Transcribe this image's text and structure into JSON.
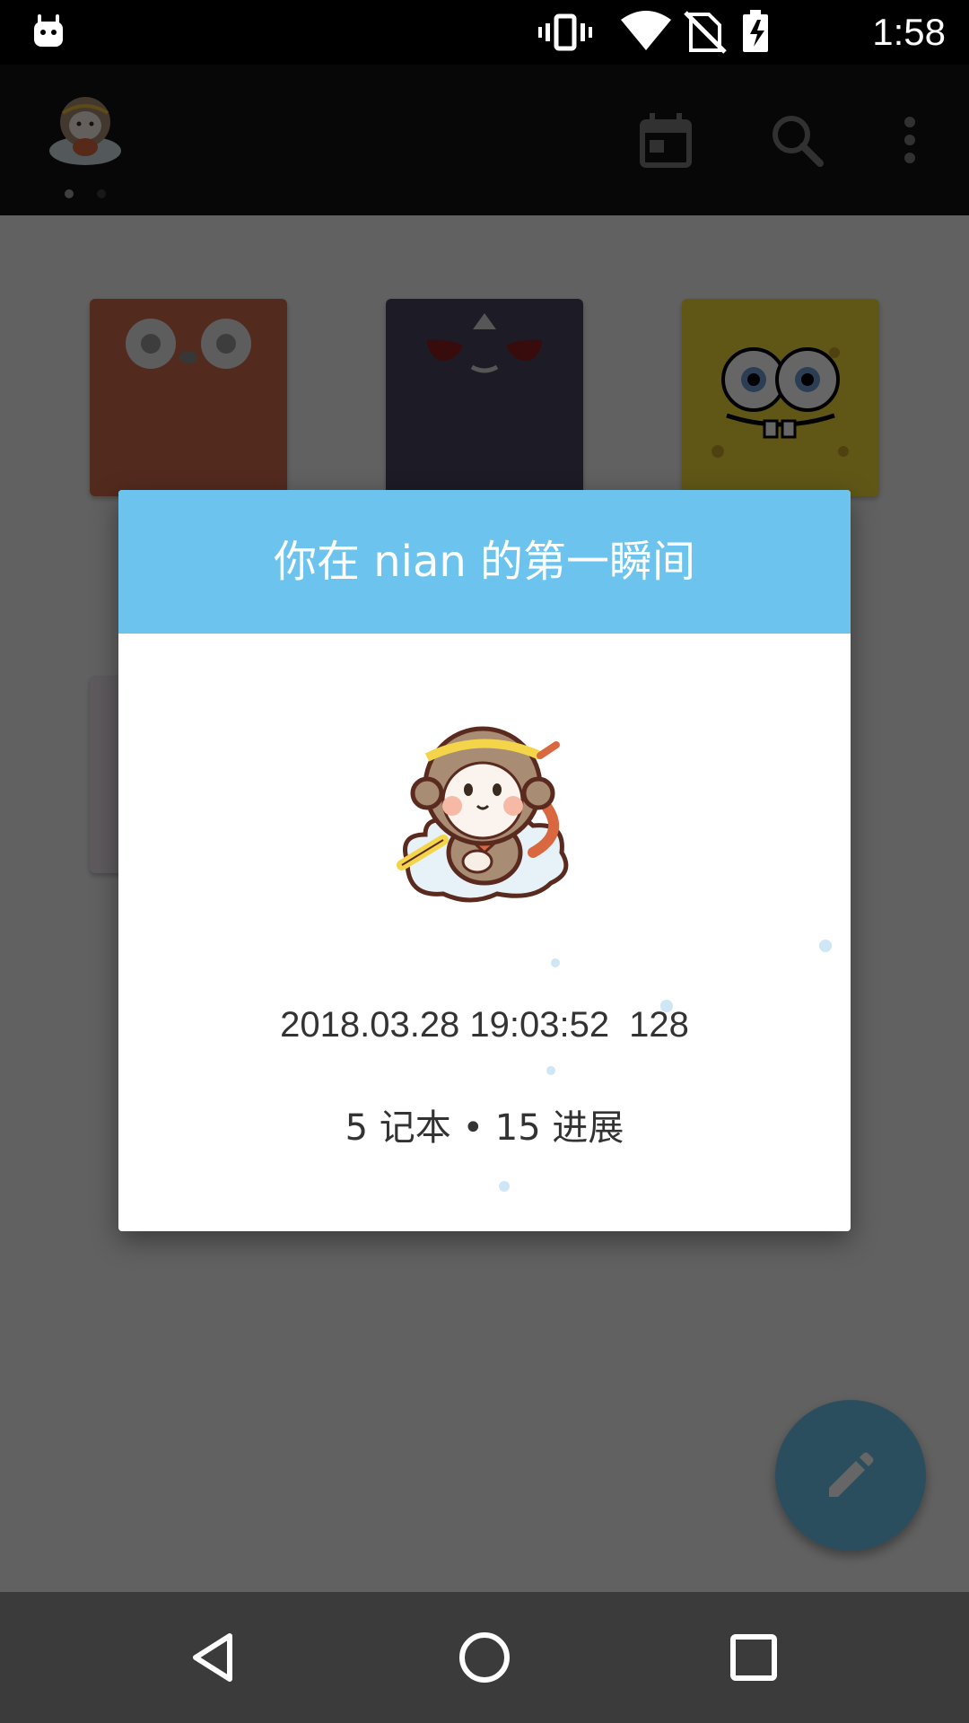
{
  "status_bar": {
    "time": "1:58",
    "icons": [
      "android-robot-icon",
      "vibrate-icon",
      "wifi-icon",
      "no-sim-icon",
      "battery-charging-icon"
    ]
  },
  "app_bar": {
    "avatar_icon": "monkey-avatar-icon",
    "actions": [
      "calendar-icon",
      "search-icon",
      "more-vert-icon"
    ],
    "page_count": 2,
    "active_page": 1
  },
  "dialog": {
    "title": "你在 nian 的第一瞬间",
    "mascot_icon": "monkey-king-mascot",
    "date": "2018.03.28 19:03:52",
    "count": "128",
    "stats": "5 记本 • 15 进展"
  },
  "fab": {
    "icon": "pencil-icon"
  },
  "nav_bar": {
    "buttons": [
      "back-icon",
      "home-icon",
      "recents-icon"
    ]
  },
  "colors": {
    "accent": "#6cc4ee",
    "status_bar": "#000000",
    "app_bar": "#121212",
    "nav_bar": "#3b3b3b"
  }
}
